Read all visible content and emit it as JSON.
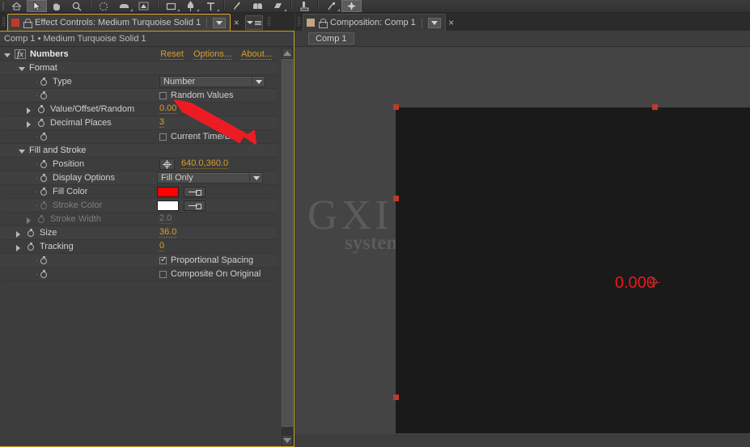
{
  "toolbar": {
    "tools": [
      {
        "name": "home-icon",
        "selected": false
      },
      {
        "name": "selection-tool-icon",
        "selected": true
      },
      {
        "name": "hand-tool-icon",
        "selected": false
      },
      {
        "name": "zoom-tool-icon",
        "selected": false
      },
      {
        "name": "orbit-camera-tool-icon",
        "selected": false
      },
      {
        "name": "pan-behind-tool-icon",
        "selected": false
      },
      {
        "name": "mask-tool-icon",
        "selected": false
      },
      {
        "name": "shape-tool-icon",
        "selected": false
      },
      {
        "name": "pen-tool-icon",
        "selected": false
      },
      {
        "name": "type-tool-icon",
        "selected": false
      },
      {
        "name": "brush-tool-icon",
        "selected": false
      },
      {
        "name": "clone-stamp-tool-icon",
        "selected": false
      },
      {
        "name": "eraser-tool-icon",
        "selected": false
      },
      {
        "name": "roto-brush-tool-icon",
        "selected": false
      },
      {
        "name": "puppet-pin-tool-icon",
        "selected": false
      },
      {
        "name": "workspace-icon",
        "selected": false
      }
    ]
  },
  "effect_controls": {
    "tab_title": "Effect Controls: Medium Turquoise Solid 1",
    "close_label": "×",
    "breadcrumb": "Comp 1 • Medium Turquoise Solid 1",
    "effect_name": "Numbers",
    "fx_badge": "fx",
    "links": [
      "Reset",
      "Options...",
      "About..."
    ],
    "accent_color": "#d89f33",
    "outline_color": "#c99a2e",
    "rows": [
      {
        "label": "Format",
        "kind": "group",
        "indent": 14
      },
      {
        "label": "Type",
        "kind": "select",
        "value": "Number",
        "indent": 34
      },
      {
        "label": "",
        "kind": "checkbox",
        "value": "Random Values",
        "checked": false,
        "indent": 34
      },
      {
        "label": "Value/Offset/Random Ma",
        "kind": "number",
        "value": "0.00",
        "indent": 28,
        "twirl": true
      },
      {
        "label": "Decimal Places",
        "kind": "number",
        "value": "3",
        "indent": 28,
        "twirl": true
      },
      {
        "label": "",
        "kind": "checkbox",
        "value": "Current Time/Date",
        "checked": false,
        "indent": 34
      },
      {
        "label": "Fill and Stroke",
        "kind": "group",
        "indent": 14
      },
      {
        "label": "Position",
        "kind": "position",
        "value": "640.0,360.0",
        "indent": 34
      },
      {
        "label": "Display Options",
        "kind": "select",
        "value": "Fill Only",
        "indent": 34
      },
      {
        "label": "Fill Color",
        "kind": "color",
        "value": "#ff0000",
        "indent": 34
      },
      {
        "label": "Stroke Color",
        "kind": "color",
        "value": "#ffffff",
        "indent": 34,
        "disabled": true
      },
      {
        "label": "Stroke Width",
        "kind": "number",
        "value": "2.0",
        "indent": 28,
        "twirl": true,
        "disabled": true
      },
      {
        "label": "Size",
        "kind": "number",
        "value": "36.0",
        "indent": 14,
        "twirl": true
      },
      {
        "label": "Tracking",
        "kind": "number",
        "value": "0",
        "indent": 14,
        "twirl": true
      },
      {
        "label": "",
        "kind": "checkbox",
        "value": "Proportional Spacing",
        "checked": true,
        "indent": 34
      },
      {
        "label": "",
        "kind": "checkbox",
        "value": "Composite On Original",
        "checked": false,
        "indent": 34
      }
    ]
  },
  "composition": {
    "tab_title": "Composition: Comp 1",
    "close_label": "×",
    "comp_chip": "Comp 1",
    "rendered_text": "0.000",
    "text_color": "#e8191a",
    "watermark_top": "GXI网",
    "watermark_bottom": "system.com",
    "handle_color": "#c0392b"
  }
}
